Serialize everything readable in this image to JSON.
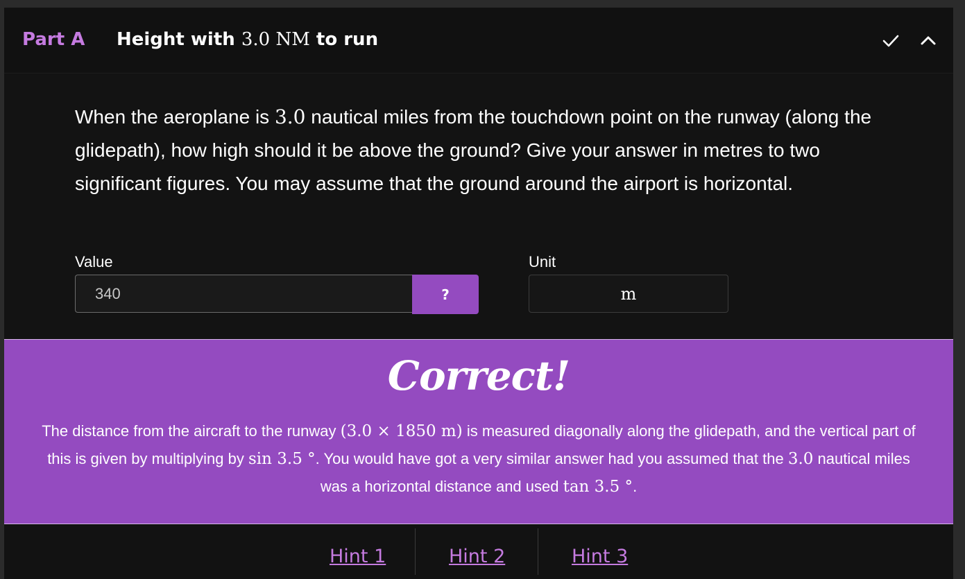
{
  "header": {
    "part_label": "Part A",
    "title_prefix": "Height with ",
    "title_math": "3.0 NM",
    "title_suffix": " to run",
    "check_icon": "check-icon",
    "collapse_icon": "chevron-up-icon"
  },
  "question": {
    "text_1": "When the aeroplane is ",
    "math_1": "3.0",
    "text_2": " nautical miles from the touchdown point on the runway (along the glidepath), how high should it be above the ground? Give your answer in metres to two significant figures. You may assume that the ground around the airport is horizontal."
  },
  "answer": {
    "value_label": "Value",
    "value": "340",
    "help_label": "?",
    "unit_label": "Unit",
    "unit_value": "m"
  },
  "feedback": {
    "heading": "Correct!",
    "text_1": "The distance from the aircraft to the runway ",
    "math_1": "(3.0 × 1850 m)",
    "text_2": " is measured diagonally along the glidepath, and the vertical part of this is given by multiplying by ",
    "math_2": "sin 3.5 °",
    "text_3": ". You would have got a very similar answer had you assumed that the ",
    "math_3": "3.0",
    "text_4": " nautical miles was a horizontal distance and used ",
    "math_4": "tan 3.5 °",
    "text_5": "."
  },
  "hints": [
    {
      "label": "Hint 1"
    },
    {
      "label": "Hint 2"
    },
    {
      "label": "Hint 3"
    }
  ],
  "colors": {
    "accent": "#c57be0",
    "feedback_bg": "#944bc0",
    "panel_bg": "#131313"
  }
}
